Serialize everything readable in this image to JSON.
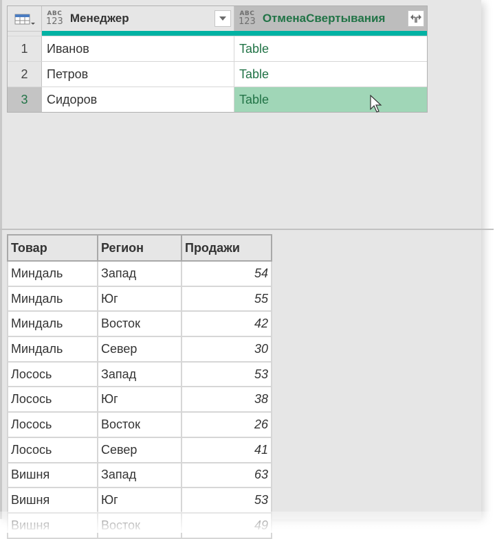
{
  "top_grid": {
    "corner_icon": "table-menu-icon",
    "columns": [
      {
        "type_badge_top": "ABC",
        "type_badge_bottom": "123",
        "title": "Менеджер",
        "button_icon": "filter-dropdown-icon"
      },
      {
        "type_badge_top": "ABC",
        "type_badge_bottom": "123",
        "title": "ОтменаСвертывания",
        "button_icon": "expand-column-icon"
      }
    ],
    "rows": [
      {
        "num": "1",
        "manager": "Иванов",
        "value": "Table"
      },
      {
        "num": "2",
        "manager": "Петров",
        "value": "Table"
      },
      {
        "num": "3",
        "manager": "Сидоров",
        "value": "Table",
        "selected": true
      }
    ],
    "colors": {
      "accent_bar": "#01b2a3",
      "table_text": "#217346",
      "selected_cell": "#a0d6b7"
    }
  },
  "preview_table": {
    "headers": [
      "Товар",
      "Регион",
      "Продажи"
    ],
    "rows": [
      [
        "Миндаль",
        "Запад",
        "54"
      ],
      [
        "Миндаль",
        "Юг",
        "55"
      ],
      [
        "Миндаль",
        "Восток",
        "42"
      ],
      [
        "Миндаль",
        "Север",
        "30"
      ],
      [
        "Лосось",
        "Запад",
        "53"
      ],
      [
        "Лосось",
        "Юг",
        "38"
      ],
      [
        "Лосось",
        "Восток",
        "26"
      ],
      [
        "Лосось",
        "Север",
        "41"
      ],
      [
        "Вишня",
        "Запад",
        "63"
      ],
      [
        "Вишня",
        "Юг",
        "53"
      ],
      [
        "Вишня",
        "Восток",
        "49"
      ]
    ]
  }
}
